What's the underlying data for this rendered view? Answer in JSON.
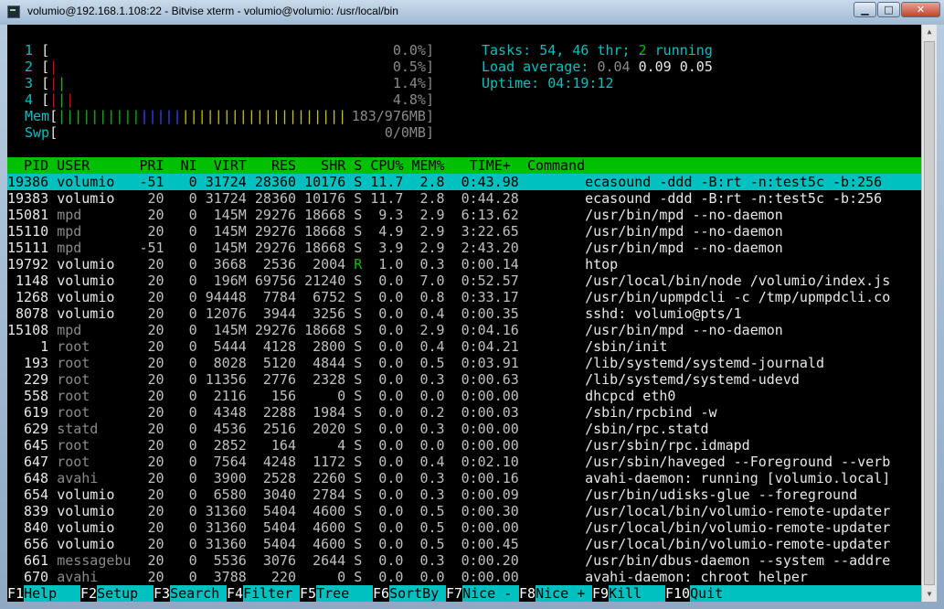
{
  "window": {
    "title": "volumio@192.168.1.108:22 - Bitvise xterm - volumio@volumio: /usr/local/bin",
    "min_label": "▁",
    "max_label": "□",
    "close_label": "✕"
  },
  "meters": {
    "cpus": [
      {
        "id": "1",
        "bars": "",
        "value": "0.0%]"
      },
      {
        "id": "2",
        "bars": "|",
        "value": "0.5%]"
      },
      {
        "id": "3",
        "bars": "||",
        "value": "1.4%]"
      },
      {
        "id": "4",
        "bars": "|||",
        "value": "4.8%]"
      }
    ],
    "mem_label": "Mem",
    "mem_bars_green": "||||||||||",
    "mem_bars_blue": "|||||",
    "mem_bars_yellow": "||||||||||||||||||||",
    "mem_value": "183/976MB]",
    "swp_label": "Swp",
    "swp_value": "0/0MB]"
  },
  "summary": {
    "tasks_label": "Tasks:",
    "tasks_count": "54",
    "threads": "46",
    "thr_label": "thr;",
    "running_count": "2",
    "running_label": "running",
    "load_label": "Load average:",
    "load1": "0.04",
    "load5": "0.09",
    "load15": "0.05",
    "uptime_label": "Uptime:",
    "uptime": "04:19:12"
  },
  "table": {
    "header": "  PID USER      PRI  NI  VIRT   RES   SHR S CPU% MEM%   TIME+  Command",
    "rows": [
      {
        "pid": "19386",
        "user": "volumio",
        "pri": "-51",
        "ni": "0",
        "virt": "31724",
        "res": "28360",
        "shr": "10176",
        "s": "S",
        "cpu": "11.7",
        "mem": "2.8",
        "time": "0:43.98",
        "cmd": "ecasound -ddd -B:rt -n:test5c -b:256"
      },
      {
        "pid": "19383",
        "user": "volumio",
        "pri": "20",
        "ni": "0",
        "virt": "31724",
        "res": "28360",
        "shr": "10176",
        "s": "S",
        "cpu": "11.7",
        "mem": "2.8",
        "time": "0:44.28",
        "cmd": "ecasound -ddd -B:rt -n:test5c -b:256"
      },
      {
        "pid": "15081",
        "user": "mpd",
        "pri": "20",
        "ni": "0",
        "virt": "145M",
        "res": "29276",
        "shr": "18668",
        "s": "S",
        "cpu": "9.3",
        "mem": "2.9",
        "time": "6:13.62",
        "cmd": "/usr/bin/mpd --no-daemon"
      },
      {
        "pid": "15110",
        "user": "mpd",
        "pri": "20",
        "ni": "0",
        "virt": "145M",
        "res": "29276",
        "shr": "18668",
        "s": "S",
        "cpu": "4.9",
        "mem": "2.9",
        "time": "3:22.65",
        "cmd": "/usr/bin/mpd --no-daemon"
      },
      {
        "pid": "15111",
        "user": "mpd",
        "pri": "-51",
        "ni": "0",
        "virt": "145M",
        "res": "29276",
        "shr": "18668",
        "s": "S",
        "cpu": "3.9",
        "mem": "2.9",
        "time": "2:43.20",
        "cmd": "/usr/bin/mpd --no-daemon"
      },
      {
        "pid": "19792",
        "user": "volumio",
        "pri": "20",
        "ni": "0",
        "virt": "3668",
        "res": "2536",
        "shr": "2004",
        "s": "R",
        "cpu": "1.0",
        "mem": "0.3",
        "time": "0:00.14",
        "cmd": "htop"
      },
      {
        "pid": "1148",
        "user": "volumio",
        "pri": "20",
        "ni": "0",
        "virt": "196M",
        "res": "69756",
        "shr": "21240",
        "s": "S",
        "cpu": "0.0",
        "mem": "7.0",
        "time": "0:52.57",
        "cmd": "/usr/local/bin/node /volumio/index.js"
      },
      {
        "pid": "1268",
        "user": "volumio",
        "pri": "20",
        "ni": "0",
        "virt": "94448",
        "res": "7784",
        "shr": "6752",
        "s": "S",
        "cpu": "0.0",
        "mem": "0.8",
        "time": "0:33.17",
        "cmd": "/usr/bin/upmpdcli -c /tmp/upmpdcli.co"
      },
      {
        "pid": "8078",
        "user": "volumio",
        "pri": "20",
        "ni": "0",
        "virt": "12076",
        "res": "3944",
        "shr": "3256",
        "s": "S",
        "cpu": "0.0",
        "mem": "0.4",
        "time": "0:00.35",
        "cmd": "sshd: volumio@pts/1"
      },
      {
        "pid": "15108",
        "user": "mpd",
        "pri": "20",
        "ni": "0",
        "virt": "145M",
        "res": "29276",
        "shr": "18668",
        "s": "S",
        "cpu": "0.0",
        "mem": "2.9",
        "time": "0:04.16",
        "cmd": "/usr/bin/mpd --no-daemon"
      },
      {
        "pid": "1",
        "user": "root",
        "pri": "20",
        "ni": "0",
        "virt": "5444",
        "res": "4128",
        "shr": "2800",
        "s": "S",
        "cpu": "0.0",
        "mem": "0.4",
        "time": "0:04.21",
        "cmd": "/sbin/init"
      },
      {
        "pid": "193",
        "user": "root",
        "pri": "20",
        "ni": "0",
        "virt": "8028",
        "res": "5120",
        "shr": "4844",
        "s": "S",
        "cpu": "0.0",
        "mem": "0.5",
        "time": "0:03.91",
        "cmd": "/lib/systemd/systemd-journald"
      },
      {
        "pid": "229",
        "user": "root",
        "pri": "20",
        "ni": "0",
        "virt": "11356",
        "res": "2776",
        "shr": "2328",
        "s": "S",
        "cpu": "0.0",
        "mem": "0.3",
        "time": "0:00.63",
        "cmd": "/lib/systemd/systemd-udevd"
      },
      {
        "pid": "558",
        "user": "root",
        "pri": "20",
        "ni": "0",
        "virt": "2116",
        "res": "156",
        "shr": "0",
        "s": "S",
        "cpu": "0.0",
        "mem": "0.0",
        "time": "0:00.00",
        "cmd": "dhcpcd eth0"
      },
      {
        "pid": "619",
        "user": "root",
        "pri": "20",
        "ni": "0",
        "virt": "4348",
        "res": "2288",
        "shr": "1984",
        "s": "S",
        "cpu": "0.0",
        "mem": "0.2",
        "time": "0:00.03",
        "cmd": "/sbin/rpcbind -w"
      },
      {
        "pid": "629",
        "user": "statd",
        "pri": "20",
        "ni": "0",
        "virt": "4536",
        "res": "2516",
        "shr": "2020",
        "s": "S",
        "cpu": "0.0",
        "mem": "0.3",
        "time": "0:00.00",
        "cmd": "/sbin/rpc.statd"
      },
      {
        "pid": "645",
        "user": "root",
        "pri": "20",
        "ni": "0",
        "virt": "2852",
        "res": "164",
        "shr": "4",
        "s": "S",
        "cpu": "0.0",
        "mem": "0.0",
        "time": "0:00.00",
        "cmd": "/usr/sbin/rpc.idmapd"
      },
      {
        "pid": "647",
        "user": "root",
        "pri": "20",
        "ni": "0",
        "virt": "7564",
        "res": "4248",
        "shr": "1172",
        "s": "S",
        "cpu": "0.0",
        "mem": "0.4",
        "time": "0:02.10",
        "cmd": "/usr/sbin/haveged --Foreground --verb"
      },
      {
        "pid": "648",
        "user": "avahi",
        "pri": "20",
        "ni": "0",
        "virt": "3900",
        "res": "2528",
        "shr": "2260",
        "s": "S",
        "cpu": "0.0",
        "mem": "0.3",
        "time": "0:00.16",
        "cmd": "avahi-daemon: running [volumio.local]"
      },
      {
        "pid": "654",
        "user": "volumio",
        "pri": "20",
        "ni": "0",
        "virt": "6580",
        "res": "3040",
        "shr": "2784",
        "s": "S",
        "cpu": "0.0",
        "mem": "0.3",
        "time": "0:00.09",
        "cmd": "/usr/bin/udisks-glue --foreground"
      },
      {
        "pid": "839",
        "user": "volumio",
        "pri": "20",
        "ni": "0",
        "virt": "31360",
        "res": "5404",
        "shr": "4600",
        "s": "S",
        "cpu": "0.0",
        "mem": "0.5",
        "time": "0:00.30",
        "cmd": "/usr/local/bin/volumio-remote-updater"
      },
      {
        "pid": "840",
        "user": "volumio",
        "pri": "20",
        "ni": "0",
        "virt": "31360",
        "res": "5404",
        "shr": "4600",
        "s": "S",
        "cpu": "0.0",
        "mem": "0.5",
        "time": "0:00.00",
        "cmd": "/usr/local/bin/volumio-remote-updater"
      },
      {
        "pid": "656",
        "user": "volumio",
        "pri": "20",
        "ni": "0",
        "virt": "31360",
        "res": "5404",
        "shr": "4600",
        "s": "S",
        "cpu": "0.0",
        "mem": "0.5",
        "time": "0:00.45",
        "cmd": "/usr/local/bin/volumio-remote-updater"
      },
      {
        "pid": "661",
        "user": "messagebu",
        "pri": "20",
        "ni": "0",
        "virt": "5536",
        "res": "3076",
        "shr": "2644",
        "s": "S",
        "cpu": "0.0",
        "mem": "0.3",
        "time": "0:00.20",
        "cmd": "/usr/bin/dbus-daemon --system --addre"
      },
      {
        "pid": "670",
        "user": "avahi",
        "pri": "20",
        "ni": "0",
        "virt": "3788",
        "res": "220",
        "shr": "0",
        "s": "S",
        "cpu": "0.0",
        "mem": "0.0",
        "time": "0:00.00",
        "cmd": "avahi-daemon: chroot helper"
      }
    ]
  },
  "function_keys": [
    {
      "key": "F1",
      "label": "Help  "
    },
    {
      "key": "F2",
      "label": "Setup "
    },
    {
      "key": "F3",
      "label": "Search"
    },
    {
      "key": "F4",
      "label": "Filter"
    },
    {
      "key": "F5",
      "label": "Tree  "
    },
    {
      "key": "F6",
      "label": "SortBy"
    },
    {
      "key": "F7",
      "label": "Nice -"
    },
    {
      "key": "F8",
      "label": "Nice +"
    },
    {
      "key": "F9",
      "label": "Kill  "
    },
    {
      "key": "F10",
      "label": "Quit  "
    }
  ],
  "colors": {
    "header_bg": "#00c000",
    "selected_bg": "#00c0c0",
    "meter_label": "#00c0c0",
    "terminal_bg": "#000000"
  }
}
